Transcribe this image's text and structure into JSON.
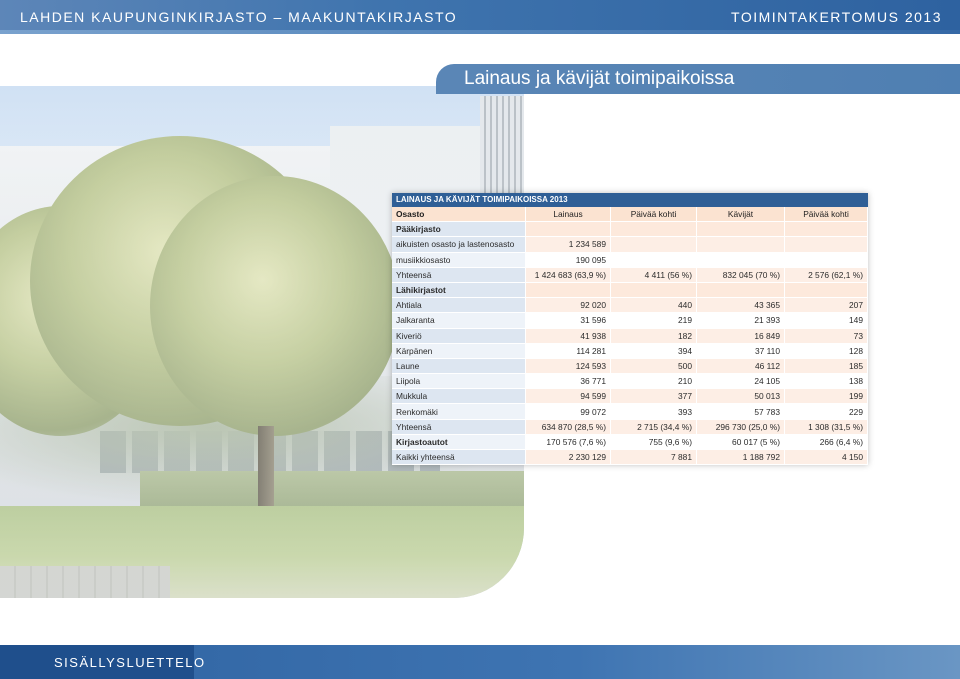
{
  "header": {
    "left": "LAHDEN KAUPUNGINKIRJASTO – MAAKUNTAKIRJASTO",
    "right": "TOIMINTAKERTOMUS 2013"
  },
  "section_title": "Lainaus ja kävijät toimipaikoissa",
  "table": {
    "caption": "LAINAUS JA KÄVIJÄT TOIMIPAIKOISSA 2013",
    "columns": [
      "Osasto",
      "Lainaus",
      "Päivää kohti",
      "Kävijät",
      "Päivää kohti"
    ],
    "rows": [
      {
        "type": "section",
        "cells": [
          "Pääkirjasto",
          "",
          "",
          "",
          ""
        ]
      },
      {
        "type": "row",
        "cells": [
          "aikuisten osasto ja lastenosasto",
          "1 234 589",
          "",
          "",
          ""
        ]
      },
      {
        "type": "row",
        "cells": [
          "musiikkiosasto",
          "190 095",
          "",
          "",
          ""
        ]
      },
      {
        "type": "row",
        "cells": [
          "Yhteensä",
          "1 424 683 (63,9 %)",
          "4 411 (56 %)",
          "832 045 (70 %)",
          "2 576 (62,1 %)"
        ]
      },
      {
        "type": "section",
        "cells": [
          "Lähikirjastot",
          "",
          "",
          "",
          ""
        ]
      },
      {
        "type": "row",
        "cells": [
          "Ahtiala",
          "92 020",
          "440",
          "43 365",
          "207"
        ]
      },
      {
        "type": "row",
        "cells": [
          "Jalkaranta",
          "31 596",
          "219",
          "21 393",
          "149"
        ]
      },
      {
        "type": "row",
        "cells": [
          "Kiveriö",
          "41 938",
          "182",
          "16 849",
          "73"
        ]
      },
      {
        "type": "row",
        "cells": [
          "Kärpänen",
          "114 281",
          "394",
          "37 110",
          "128"
        ]
      },
      {
        "type": "row",
        "cells": [
          "Laune",
          "124 593",
          "500",
          "46 112",
          "185"
        ]
      },
      {
        "type": "row",
        "cells": [
          "Liipola",
          "36 771",
          "210",
          "24 105",
          "138"
        ]
      },
      {
        "type": "row",
        "cells": [
          "Mukkula",
          "94 599",
          "377",
          "50 013",
          "199"
        ]
      },
      {
        "type": "row",
        "cells": [
          "Renkomäki",
          "99 072",
          "393",
          "57 783",
          "229"
        ]
      },
      {
        "type": "row",
        "cells": [
          "Yhteensä",
          "634 870 (28,5 %)",
          "2 715 (34,4 %)",
          "296 730 (25,0 %)",
          "1 308 (31,5 %)"
        ]
      },
      {
        "type": "bold",
        "cells": [
          "Kirjastoautot",
          "170 576 (7,6 %)",
          "755 (9,6 %)",
          "60 017 (5 %)",
          "266 (6,4 %)"
        ]
      },
      {
        "type": "row",
        "cells": [
          "Kaikki yhteensä",
          "2 230 129",
          "7 881",
          "1 188 792",
          "4 150"
        ]
      }
    ]
  },
  "footer": {
    "toc_label": "SISÄLLYSLUETTELO"
  },
  "colors": {
    "brand_blue": "#2e62a0",
    "table_header": "#2f5f96",
    "row_tint": "#fdeee5",
    "label_tint": "#dde6f1"
  }
}
